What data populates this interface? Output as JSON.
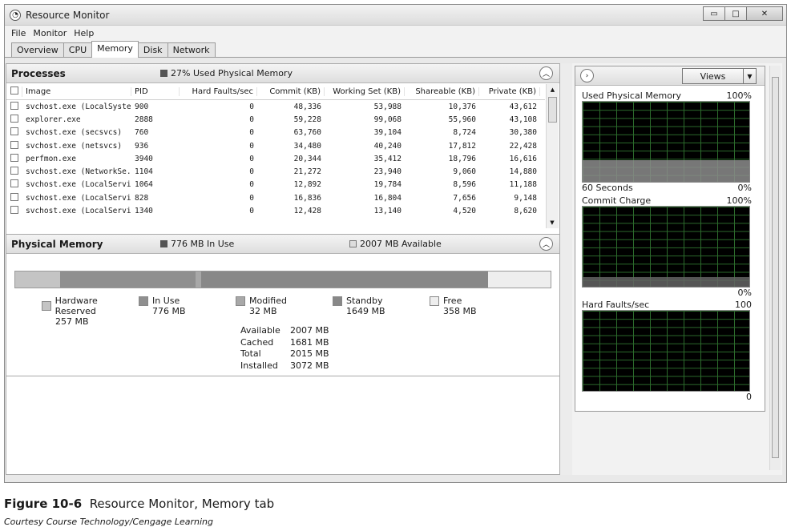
{
  "window": {
    "title": "Resource Monitor",
    "controls": {
      "minimize": "▭",
      "maximize": "□",
      "close": "✕"
    }
  },
  "menu": [
    "File",
    "Monitor",
    "Help"
  ],
  "tabs": [
    "Overview",
    "CPU",
    "Memory",
    "Disk",
    "Network"
  ],
  "active_tab": "Memory",
  "processes": {
    "title": "Processes",
    "legend": "27% Used Physical Memory",
    "headers": [
      "Image",
      "PID",
      "Hard Faults/sec",
      "Commit (KB)",
      "Working Set (KB)",
      "Shareable (KB)",
      "Private (KB)"
    ],
    "rows": [
      [
        "svchost.exe (LocalSyste...",
        "900",
        "0",
        "48,336",
        "53,988",
        "10,376",
        "43,612"
      ],
      [
        "explorer.exe",
        "2888",
        "0",
        "59,228",
        "99,068",
        "55,960",
        "43,108"
      ],
      [
        "svchost.exe (secsvcs)",
        "760",
        "0",
        "63,760",
        "39,104",
        "8,724",
        "30,380"
      ],
      [
        "svchost.exe (netsvcs)",
        "936",
        "0",
        "34,480",
        "40,240",
        "17,812",
        "22,428"
      ],
      [
        "perfmon.exe",
        "3940",
        "0",
        "20,344",
        "35,412",
        "18,796",
        "16,616"
      ],
      [
        "svchost.exe (NetworkSe...",
        "1104",
        "0",
        "21,272",
        "23,940",
        "9,060",
        "14,880"
      ],
      [
        "svchost.exe (LocalService)",
        "1064",
        "0",
        "12,892",
        "19,784",
        "8,596",
        "11,188"
      ],
      [
        "svchost.exe (LocalServic...",
        "828",
        "0",
        "16,836",
        "16,804",
        "7,656",
        "9,148"
      ],
      [
        "svchost.exe (LocalServic...",
        "1340",
        "0",
        "12,428",
        "13,140",
        "4,520",
        "8,620"
      ]
    ]
  },
  "physical_memory": {
    "title": "Physical Memory",
    "in_use_label": "776 MB In Use",
    "available_label": "2007 MB Available",
    "legend": [
      {
        "name": "Hardware Reserved",
        "value": "257 MB",
        "color": "#c4c4c4"
      },
      {
        "name": "In Use",
        "value": "776 MB",
        "color": "#8f8f8f"
      },
      {
        "name": "Modified",
        "value": "32 MB",
        "color": "#a8a8a8"
      },
      {
        "name": "Standby",
        "value": "1649 MB",
        "color": "#888888"
      },
      {
        "name": "Free",
        "value": "358 MB",
        "color": "#eeeeee"
      }
    ],
    "bar_mb": {
      "hardware_reserved": 257,
      "in_use": 776,
      "modified": 32,
      "standby": 1649,
      "free": 358
    },
    "stats": [
      {
        "label": "Available",
        "value": "2007 MB"
      },
      {
        "label": "Cached",
        "value": "1681 MB"
      },
      {
        "label": "Total",
        "value": "2015 MB"
      },
      {
        "label": "Installed",
        "value": "3072 MB"
      }
    ]
  },
  "right_panel": {
    "views_label": "Views",
    "graphs": [
      {
        "title": "Used Physical Memory",
        "max": "100%",
        "foot_left": "60 Seconds",
        "foot_right": "0%",
        "level": 0.27
      },
      {
        "title": "Commit Charge",
        "max": "100%",
        "foot_left": "",
        "foot_right": "0%",
        "level": 0.12
      },
      {
        "title": "Hard Faults/sec",
        "max": "100",
        "foot_left": "",
        "foot_right": "0",
        "level": 0
      }
    ]
  },
  "caption": {
    "figure": "Figure 10-6",
    "text": "Resource Monitor, Memory tab",
    "courtesy": "Courtesy Course Technology/Cengage Learning"
  }
}
